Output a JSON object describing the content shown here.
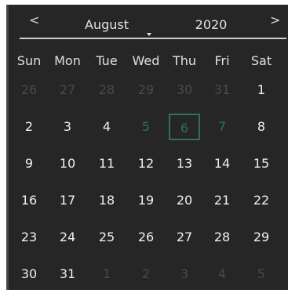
{
  "header": {
    "prev_label": "<",
    "next_label": ">",
    "month": "August",
    "year": "2020"
  },
  "weekdays": [
    "Sun",
    "Mon",
    "Tue",
    "Wed",
    "Thu",
    "Fri",
    "Sat"
  ],
  "days": [
    {
      "label": "26",
      "state": "other-month"
    },
    {
      "label": "27",
      "state": "other-month"
    },
    {
      "label": "28",
      "state": "other-month"
    },
    {
      "label": "29",
      "state": "other-month"
    },
    {
      "label": "30",
      "state": "other-month"
    },
    {
      "label": "31",
      "state": "other-month"
    },
    {
      "label": "1",
      "state": "normal"
    },
    {
      "label": "2",
      "state": "normal"
    },
    {
      "label": "3",
      "state": "normal"
    },
    {
      "label": "4",
      "state": "normal"
    },
    {
      "label": "5",
      "state": "in-range"
    },
    {
      "label": "6",
      "state": "selected"
    },
    {
      "label": "7",
      "state": "in-range"
    },
    {
      "label": "8",
      "state": "normal"
    },
    {
      "label": "9",
      "state": "normal"
    },
    {
      "label": "10",
      "state": "normal"
    },
    {
      "label": "11",
      "state": "normal"
    },
    {
      "label": "12",
      "state": "normal"
    },
    {
      "label": "13",
      "state": "normal"
    },
    {
      "label": "14",
      "state": "normal"
    },
    {
      "label": "15",
      "state": "normal"
    },
    {
      "label": "16",
      "state": "normal"
    },
    {
      "label": "17",
      "state": "normal"
    },
    {
      "label": "18",
      "state": "normal"
    },
    {
      "label": "19",
      "state": "normal"
    },
    {
      "label": "20",
      "state": "normal"
    },
    {
      "label": "21",
      "state": "normal"
    },
    {
      "label": "22",
      "state": "normal"
    },
    {
      "label": "23",
      "state": "normal"
    },
    {
      "label": "24",
      "state": "normal"
    },
    {
      "label": "25",
      "state": "normal"
    },
    {
      "label": "26",
      "state": "normal"
    },
    {
      "label": "27",
      "state": "normal"
    },
    {
      "label": "28",
      "state": "normal"
    },
    {
      "label": "29",
      "state": "normal"
    },
    {
      "label": "30",
      "state": "normal"
    },
    {
      "label": "31",
      "state": "normal"
    },
    {
      "label": "1",
      "state": "other-month"
    },
    {
      "label": "2",
      "state": "other-month"
    },
    {
      "label": "3",
      "state": "other-month"
    },
    {
      "label": "4",
      "state": "other-month"
    },
    {
      "label": "5",
      "state": "other-month"
    }
  ],
  "colors": {
    "background": "#262626",
    "text": "#f0f0f0",
    "other_month": "#4a4a4a",
    "accent": "#2e6e62"
  }
}
